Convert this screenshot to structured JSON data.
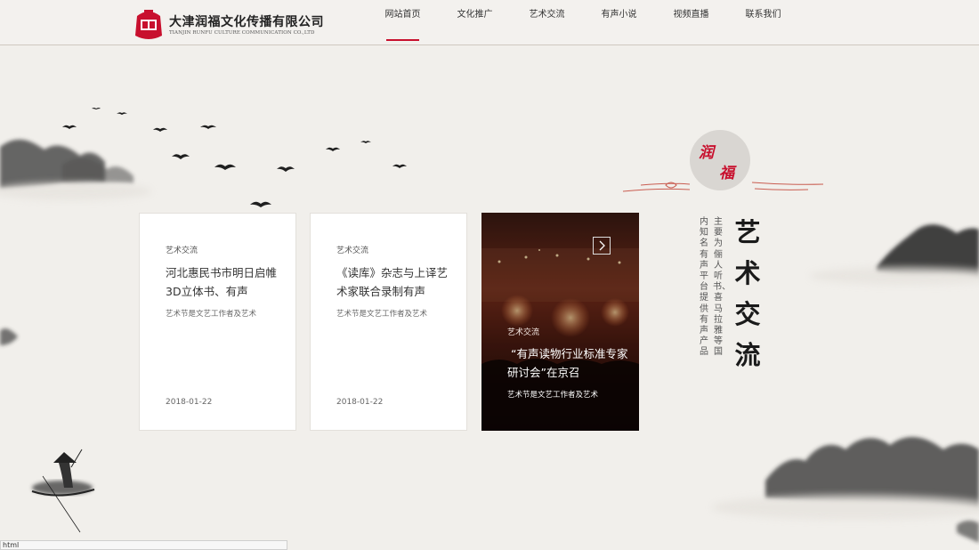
{
  "logo": {
    "name_cn": "大津润福文化传播有限公司",
    "name_en": "TIANJIN RUNFU CULTURE COMMUNICATION CO.,LTD",
    "seal_icon": "seal-logo-icon"
  },
  "nav": {
    "items": [
      {
        "label": "网站首页",
        "active": true
      },
      {
        "label": "文化推广",
        "active": false
      },
      {
        "label": "艺术交流",
        "active": false
      },
      {
        "label": "有声小说",
        "active": false
      },
      {
        "label": "视频直播",
        "active": false
      },
      {
        "label": "联系我们",
        "active": false
      }
    ]
  },
  "cards": [
    {
      "category": "艺术交流",
      "title": "河北惠民书市明日启帷 3D立体书、有声",
      "desc": "艺术节是文艺工作者及艺术",
      "date": "2018-01-22"
    },
    {
      "category": "艺术交流",
      "title": "《读库》杂志与上译艺术家联合录制有声",
      "desc": "艺术节是文艺工作者及艺术",
      "date": "2018-01-22"
    },
    {
      "category": "艺术交流",
      "title": "“有声读物行业标准专家研讨会”在京召",
      "desc": "艺术节是文艺工作者及艺术"
    }
  ],
  "aside": {
    "circle_char_1": "润",
    "circle_char_2": "福",
    "big_title": "艺术交流",
    "columns": [
      "主要为俪人听书、喜马拉雅等国",
      "内知名有声平台提供有声产品"
    ]
  },
  "status_bar": {
    "text": "html"
  },
  "colors": {
    "accent": "#c8102e",
    "background": "#f1efeb",
    "card": "#ffffff"
  }
}
